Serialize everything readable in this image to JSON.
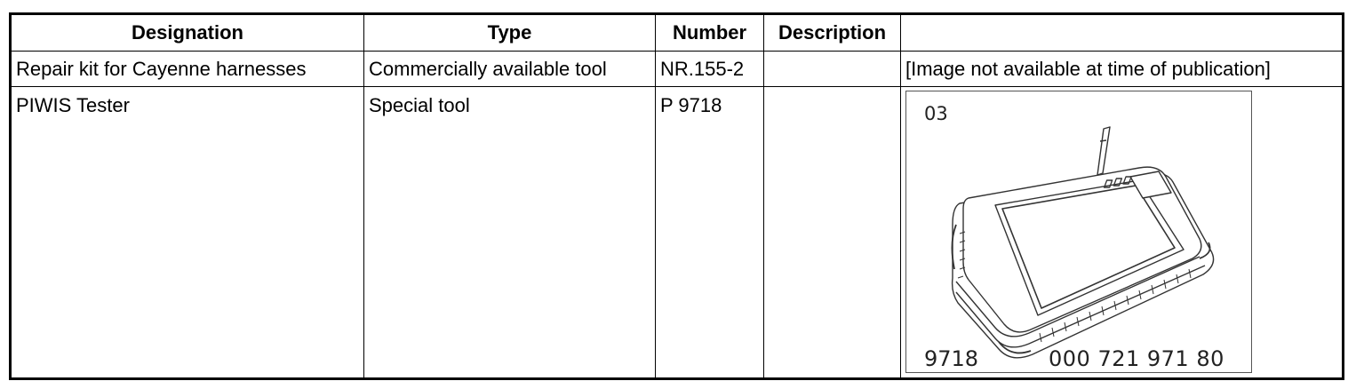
{
  "table": {
    "headers": [
      "Designation",
      "Type",
      "Number",
      "Description",
      ""
    ],
    "rows": [
      {
        "designation": "Repair kit for Cayenne harnesses",
        "type": "Commercially available tool",
        "number": "NR.155-2",
        "description": "",
        "image_text": "[Image not available at time of publication]"
      },
      {
        "designation": "PIWIS Tester",
        "type": "Special tool",
        "number": "P 9718",
        "description": "",
        "image": {
          "icon": "piwis-tester-illustration",
          "figure_number": "03",
          "tool_number": "9718",
          "part_number": "000 721 971 80"
        }
      }
    ]
  }
}
